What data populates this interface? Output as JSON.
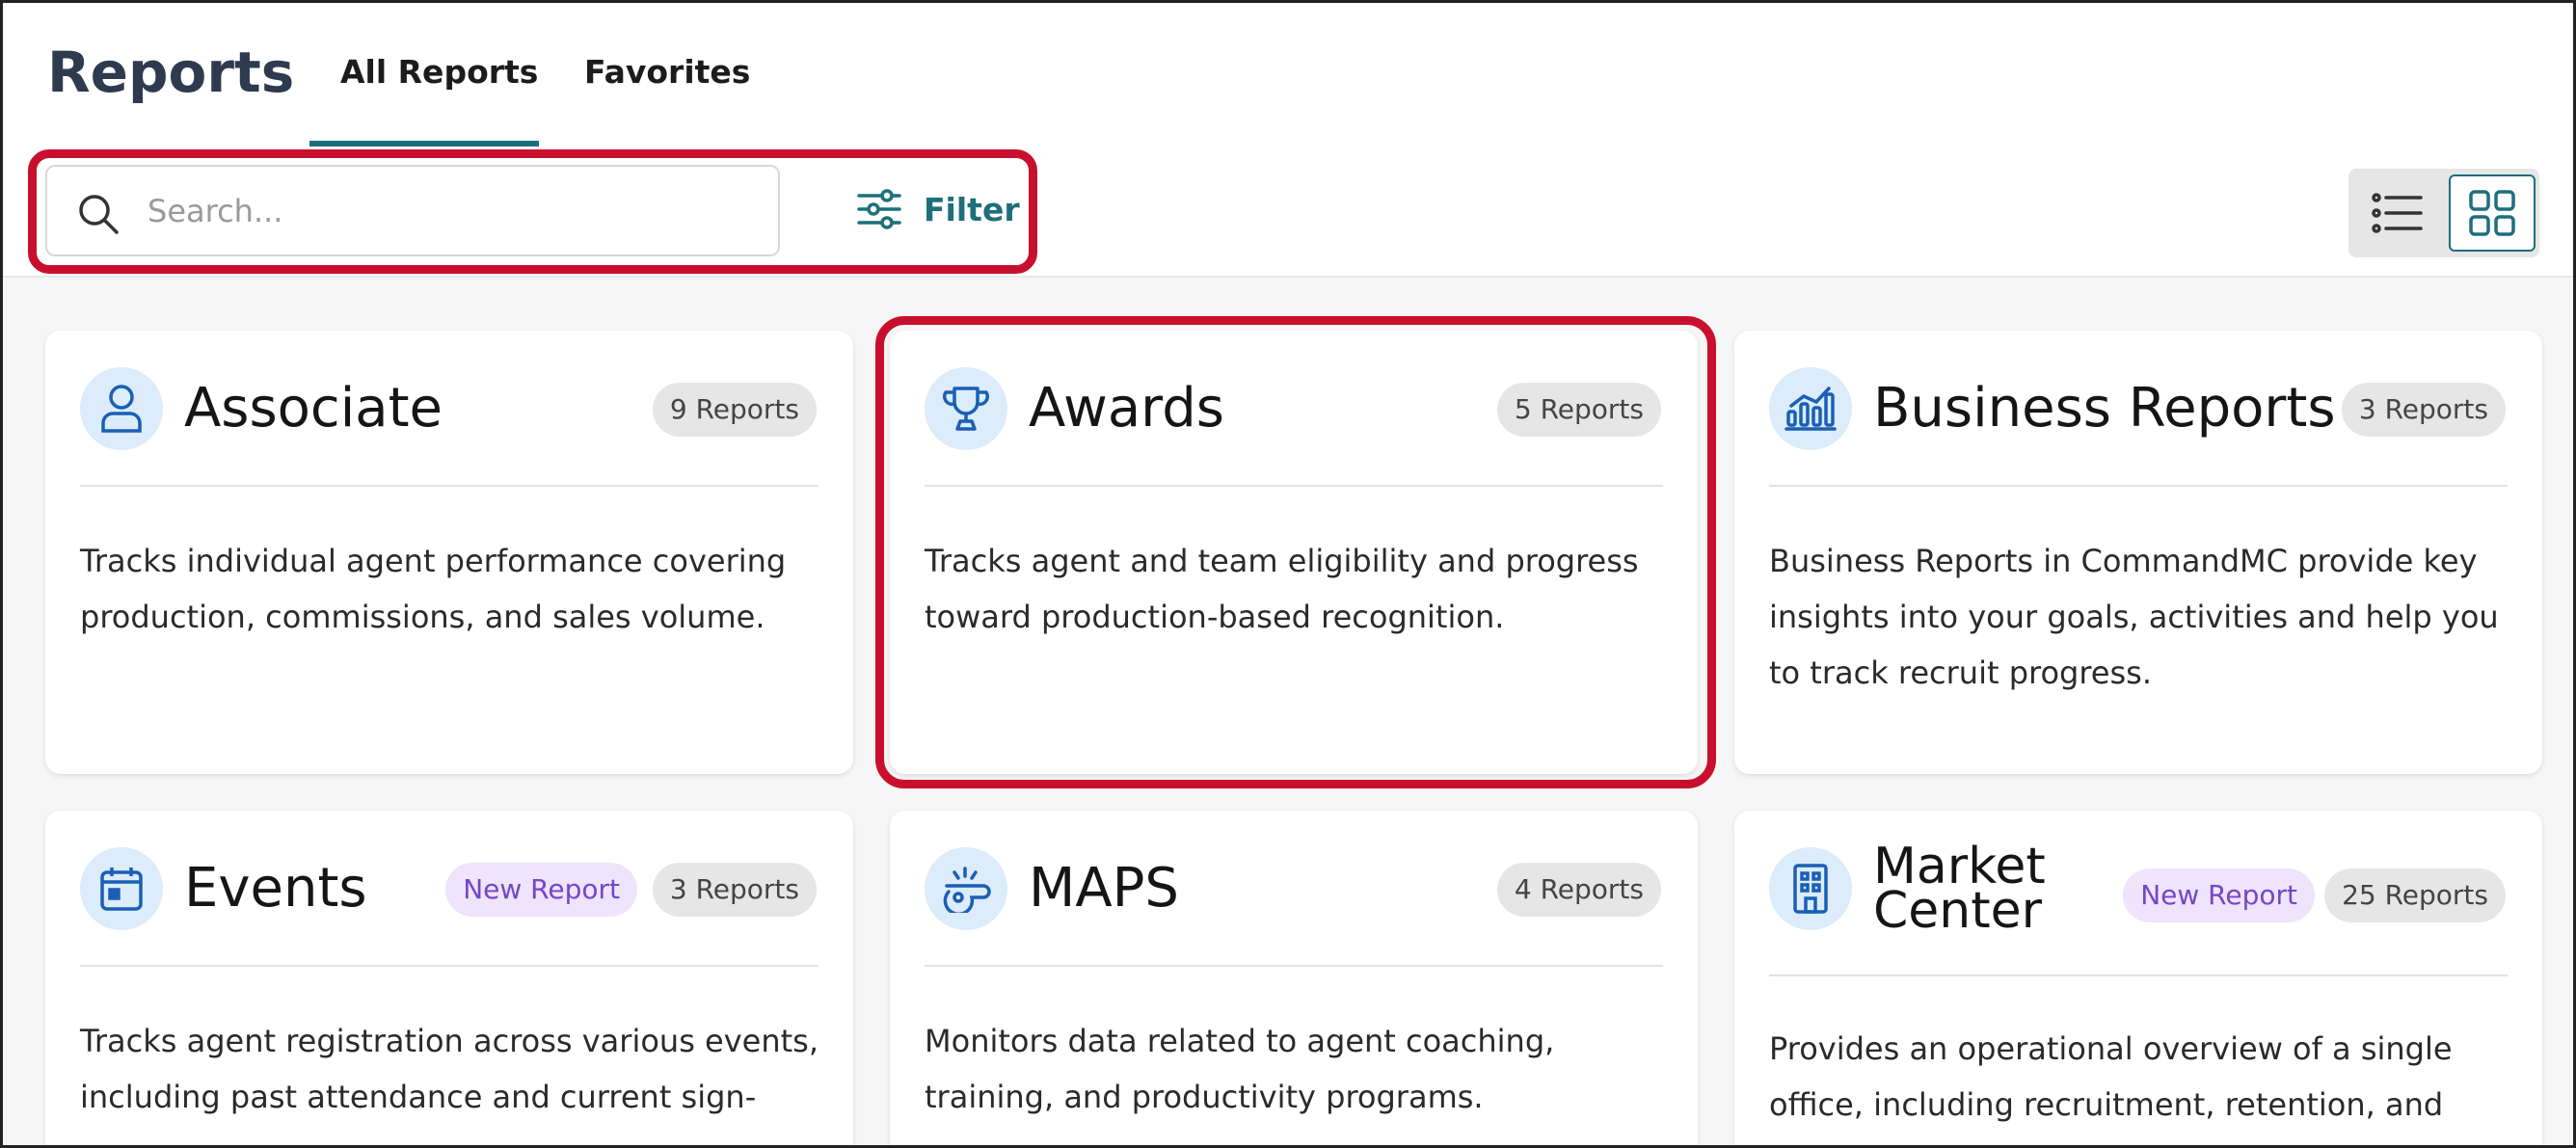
{
  "header": {
    "title": "Reports",
    "tabs": [
      {
        "label": "All Reports",
        "active": true
      },
      {
        "label": "Favorites",
        "active": false
      }
    ]
  },
  "toolbar": {
    "search_placeholder": "Search...",
    "search_value": "",
    "filter_label": "Filter",
    "view_modes": [
      "list-view-icon",
      "grid-view-icon"
    ],
    "active_view": "grid"
  },
  "colors": {
    "accent": "#1d6f7c",
    "highlight": "#c8102e",
    "icon_bg": "#dcecfb",
    "new_badge_bg": "#eee4fb",
    "new_badge_text": "#7446c9"
  },
  "cards": [
    {
      "icon": "person-icon",
      "title": "Associate",
      "new_badge": "",
      "count": "9 Reports",
      "description": "Tracks individual agent performance covering production, commissions, and sales volume."
    },
    {
      "icon": "trophy-icon",
      "title": "Awards",
      "new_badge": "",
      "count": "5 Reports",
      "description": "Tracks agent and team eligibility and progress toward production-based recognition."
    },
    {
      "icon": "bar-chart-icon",
      "title": "Business Reports",
      "new_badge": "",
      "count": "3 Reports",
      "description": "Business Reports in CommandMC provide key insights into your goals, activities and help you to track recruit progress."
    },
    {
      "icon": "calendar-icon",
      "title": "Events",
      "new_badge": "New Report",
      "count": "3 Reports",
      "description": "Tracks agent registration across various events, including past attendance and current sign-ups."
    },
    {
      "icon": "whistle-icon",
      "title": "MAPS",
      "new_badge": "",
      "count": "4 Reports",
      "description": "Monitors data related to agent coaching, training, and productivity programs."
    },
    {
      "icon": "building-icon",
      "title": "Market Center",
      "new_badge": "New Report",
      "count": "25 Reports",
      "description": "Provides an operational overview of a single office, including recruitment, retention, and"
    }
  ]
}
